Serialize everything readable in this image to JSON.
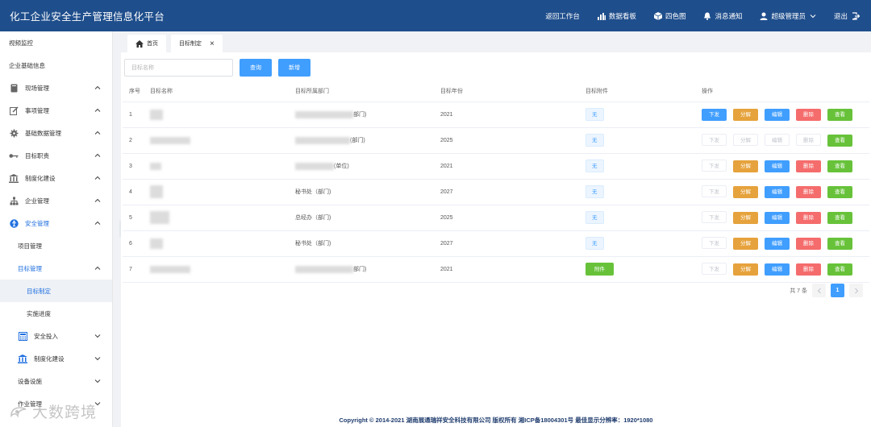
{
  "header": {
    "title": "化工企业安全生产管理信息化平台",
    "back_workbench": "返回工作台",
    "data_board": "数据看板",
    "four_color": "四色图",
    "messages": "消息通知",
    "user": "超级管理员",
    "logout": "退出"
  },
  "sidebar": {
    "video": "视频监控",
    "company_info": "企业基础信息",
    "site": "现场管理",
    "affairs": "事项管理",
    "base_data": "基础数据管理",
    "duties": "目标职责",
    "institution": "制度化建设",
    "enterprise": "企业管理",
    "safety": "安全管理",
    "project": "项目管理",
    "goal": "目标管理",
    "goal_make": "目标制定",
    "progress": "实施进度",
    "invest": "安全投入",
    "institution2": "制度化建设",
    "equipment": "设备设施",
    "work": "作业管理"
  },
  "tabs": {
    "home": "首页",
    "current": "目标制定"
  },
  "toolbar": {
    "placeholder": "目标名称",
    "query": "查询",
    "add": "新增"
  },
  "table": {
    "headers": [
      "序号",
      "目标名称",
      "目标所属部门",
      "目标年份",
      "目标附件",
      "操作"
    ],
    "rows": [
      {
        "no": "1",
        "dept": "部门)",
        "year": "2021",
        "attach": "无"
      },
      {
        "no": "2",
        "dept": "(部门)",
        "year": "2025",
        "attach": "无"
      },
      {
        "no": "3",
        "dept": "(单位)",
        "year": "2021",
        "attach": "无"
      },
      {
        "no": "4",
        "dept": "秘书处（部门)",
        "year": "2027",
        "attach": "无"
      },
      {
        "no": "5",
        "dept": "总经办（部门)",
        "year": "2025",
        "attach": "无"
      },
      {
        "no": "6",
        "dept": "秘书处（部门)",
        "year": "2027",
        "attach": "无"
      },
      {
        "no": "7",
        "dept": "部门)",
        "year": "2021",
        "attach": "附件"
      }
    ],
    "actions": {
      "down": "下发",
      "split": "分解",
      "edit": "编辑",
      "del": "删除",
      "view": "查看"
    }
  },
  "pager": {
    "total": "共 7 条",
    "page": "1"
  },
  "footer": "Copyright © 2014-2021 湖南展通瑞祥安全科技有限公司 版权所有 湘ICP备18004301号 最佳显示分辨率：1920*1080",
  "watermark": "大数跨境",
  "colors": {
    "header": "#1f4e8c",
    "primary": "#409eff",
    "warning": "#e6a23c",
    "danger": "#f56c6c",
    "success": "#67c23a"
  }
}
